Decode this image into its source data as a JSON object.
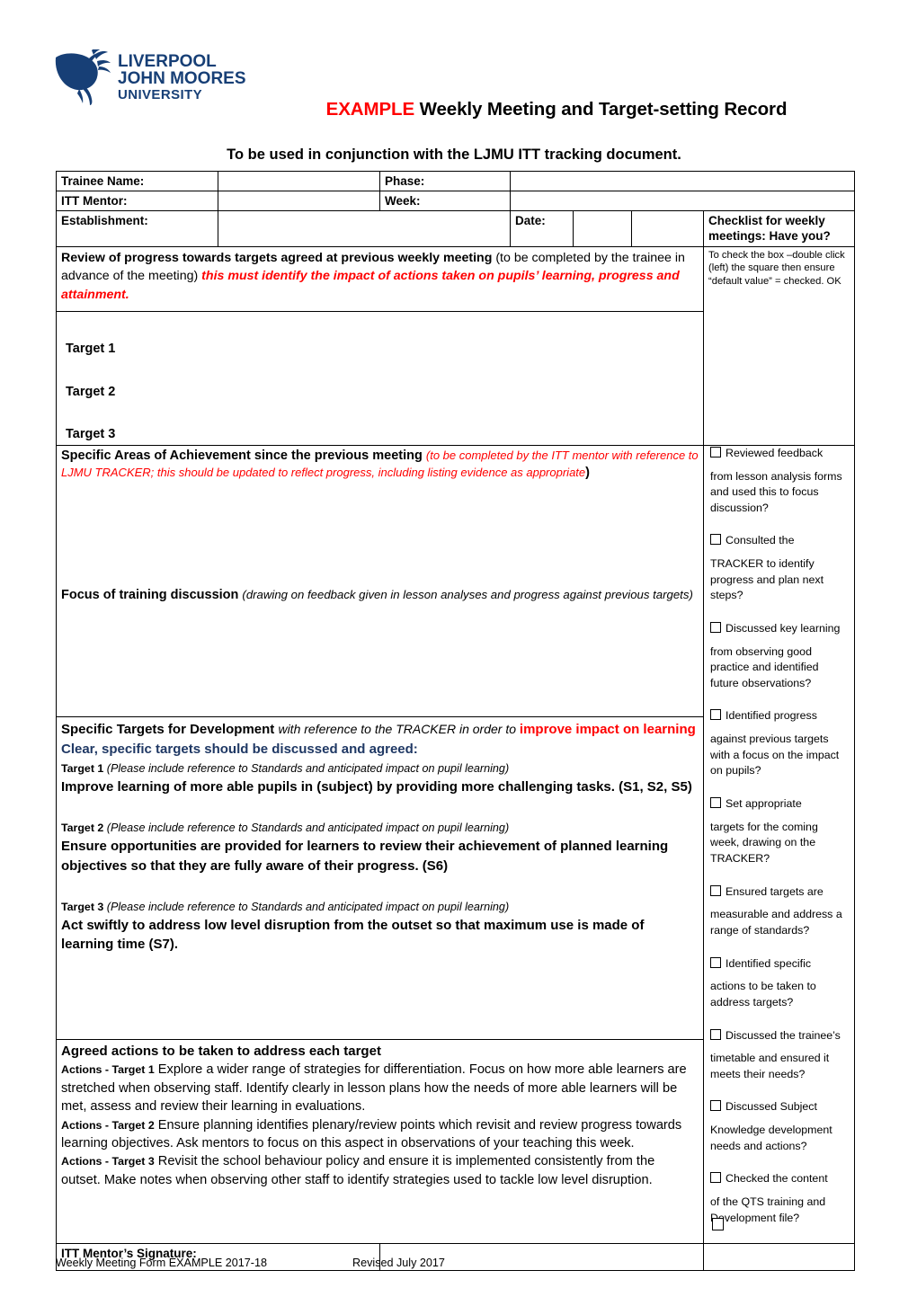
{
  "header": {
    "logo_alt": "Liverpool John Moores University",
    "logo_line1": "LIVERPOOL",
    "logo_line2": "JOHN MOORES",
    "logo_line3": "UNIVERSITY",
    "title_example": "EXAMPLE",
    "title_rest": " Weekly Meeting and Target-setting Record",
    "subtitle": "To be used in conjunction with the LJMU ITT tracking document."
  },
  "form": {
    "trainee_name_label": "Trainee Name:",
    "trainee_name_value": "",
    "phase_label": "Phase:",
    "phase_value": "",
    "itt_mentor_label": "ITT Mentor:",
    "itt_mentor_value": "",
    "week_label": "Week:",
    "week_value": "",
    "establishment_label": "Establishment:",
    "establishment_value": "",
    "date_label": "Date:",
    "date_value": "",
    "checklist_header": "Checklist for weekly meetings: Have you?",
    "checklist_note": "To check the box –double click (left) the square then ensure “default value” = checked. OK",
    "signature_label": "ITT  Mentor’s Signature:",
    "signature_value": ""
  },
  "review": {
    "bold_part": "Review of progress towards targets agreed at previous weekly meeting",
    "plain_part": " (to be completed by the trainee in advance of the meeting) ",
    "red_part": "this must identify the impact of actions taken on pupils’ learning, progress and attainment."
  },
  "targets_prev": {
    "target1": "Target 1",
    "target2": "Target 2",
    "target3": "Target 3"
  },
  "achievement": {
    "bold": "Specific Areas of Achievement since the previous meeting ",
    "paren_open": "(",
    "red_italic": "to be completed by the ITT mentor with reference to LJMU TRACKER; this should  be updated to reflect progress, including listing evidence as appropriate",
    "paren_close": ")"
  },
  "focus": {
    "bold": "Focus of training discussion ",
    "italic": "(drawing on feedback given in lesson analyses and progress against previous targets)"
  },
  "targets_dev": {
    "head_bold": "Specific Targets for Development ",
    "head_italic": "with reference to the TRACKER in order to ",
    "head_red": "improve impact on learning",
    "head_blue": " Clear, specific targets should be discussed and agreed:",
    "items": [
      {
        "label": "Target 1",
        "hint": " (Please include reference to Standards and anticipated impact on pupil learning)",
        "body": "Improve learning of more able pupils in (subject) by providing more challenging tasks. (S1, S2, S5)"
      },
      {
        "label": "Target 2",
        "hint": " (Please include reference to Standards and anticipated impact on pupil learning)",
        "body": "Ensure opportunities are provided for learners to review their achievement of planned learning objectives so that they are fully aware of their progress. (S6)"
      },
      {
        "label": "Target 3",
        "hint": " (Please include reference to Standards and anticipated impact on pupil learning)",
        "body": "Act swiftly to address low level disruption from the outset so that maximum use is made of learning time (S7)."
      }
    ]
  },
  "agreed_actions": {
    "heading": "Agreed actions to be taken to address each target",
    "items": [
      {
        "label": "Actions - Target 1",
        "body": " Explore a wider range of strategies for differentiation. Focus on how more able learners are stretched when observing staff. Identify clearly in lesson plans how the needs of more able learners will be met, assess and review their learning in evaluations."
      },
      {
        "label": "Actions - Target 2",
        "body": " Ensure planning identifies plenary/review points which revisit and review progress towards learning objectives. Ask mentors to focus on this aspect in observations of your teaching this week."
      },
      {
        "label": "Actions - Target 3",
        "body": " Revisit the school behaviour policy and ensure it is implemented consistently from the outset. Make notes when observing other staff to identify strategies used to tackle low level disruption."
      }
    ]
  },
  "checklist": {
    "items": [
      {
        "first": "Reviewed feedback",
        "rest": "from lesson analysis forms and used this to focus discussion?"
      },
      {
        "first": "Consulted the",
        "rest": "TRACKER to identify progress and plan next steps?"
      },
      {
        "first": "Discussed key learning",
        "rest": "from observing good practice and identified future observations?"
      },
      {
        "first": "Identified progress",
        "rest": "against previous targets with a focus on the impact on pupils?"
      },
      {
        "first": "Set appropriate",
        "rest": "targets for the coming week, drawing on the TRACKER?"
      },
      {
        "first": "Ensured targets are",
        "rest": "measurable and address a range of standards?"
      },
      {
        "first": "Identified specific",
        "rest": "actions to be taken to address targets?"
      },
      {
        "first": "Discussed the trainee’s",
        "rest": "timetable and ensured it meets their needs?"
      },
      {
        "first": "Discussed Subject",
        "rest": "Knowledge development needs and actions?"
      },
      {
        "first": "Checked the content",
        "rest": "of the QTS training and Development file?"
      }
    ]
  },
  "footer": {
    "left": "Weekly Meeting Form EXAMPLE 2017-18",
    "right": "Revised July 2017"
  },
  "colors": {
    "red": "#FF0000",
    "blue": "#1F3864",
    "logo_blue": "#173F76"
  }
}
